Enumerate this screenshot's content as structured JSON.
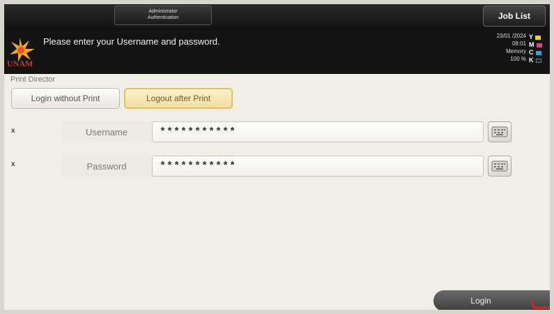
{
  "topbar": {
    "tab_line1": "Administrator",
    "tab_line2": "Authentication",
    "job_list": "Job List"
  },
  "header": {
    "logo_text": "UNAM",
    "message": "Please enter your Username and password.",
    "date": "23/01 /2024",
    "time": "08:01",
    "memory_label": "Memory",
    "memory_value": "100 %",
    "toner": [
      {
        "letter": "Y",
        "color": "#f2d600"
      },
      {
        "letter": "M",
        "color": "#e0409a"
      },
      {
        "letter": "C",
        "color": "#29a9e0"
      },
      {
        "letter": "K",
        "color": "#222222"
      }
    ]
  },
  "panel": {
    "title": "Print Director",
    "login_without_print": "Login without Print",
    "logout_after_print": "Logout after Print",
    "username_mark": "x",
    "username_label": "Username",
    "username_value": "***********",
    "password_mark": "x",
    "password_label": "Password",
    "password_value": "***********",
    "login_button": "Login"
  },
  "colors": {
    "accent_selected": "#f3df9f",
    "header_bg": "#141414"
  }
}
